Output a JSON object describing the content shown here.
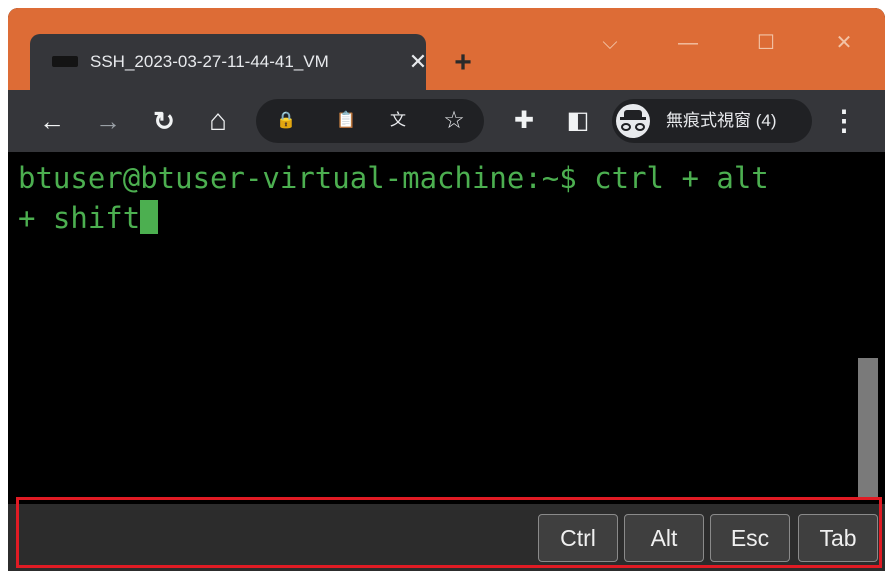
{
  "browser": {
    "tab": {
      "title": "SSH_2023-03-27-11-44-41_VM",
      "close_glyph": "✕",
      "favicon": "terminal-favicon"
    },
    "new_tab_glyph": "+",
    "window_controls": {
      "tabs_menu_glyph": "⌵",
      "minimize_glyph": "—",
      "maximize_glyph": "☐",
      "close_glyph": "✕"
    },
    "toolbar": {
      "back_glyph": "←",
      "forward_glyph": "→",
      "reload_glyph": "↻",
      "home_glyph": "⌂",
      "lock_glyph": "🔒",
      "clipboard_glyph": "📋",
      "translate_glyph": "文",
      "star_glyph": "☆",
      "extensions_glyph": "✚",
      "sidepanel_glyph": "◧",
      "menu_glyph": "⋮",
      "incognito_label": "無痕式視窗 (4)"
    }
  },
  "terminal": {
    "prompt": "btuser@btuser-virtual-machine:~$",
    "line1_command": " ctrl + alt",
    "line2": "+ shift",
    "text_color": "#4caf50",
    "background": "#000000"
  },
  "keybar": {
    "keys": [
      "Ctrl",
      "Alt",
      "Esc",
      "Tab"
    ]
  },
  "colors": {
    "titlebar": "#dd6c36",
    "highlight_border": "#e01b24"
  }
}
